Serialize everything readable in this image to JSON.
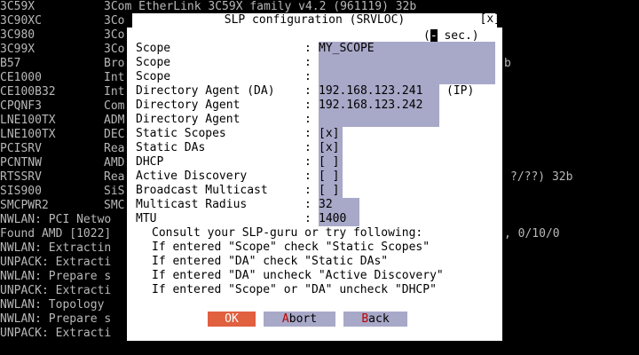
{
  "background_lines": [
    {
      "left": "3C59X",
      "right": "3Com EtherLink 3C59X family v4.2 (961119) 32b"
    },
    {
      "left": "3C90XC",
      "right": "3Co"
    },
    {
      "left": "3C980",
      "right": "3Co"
    },
    {
      "left": "3C99X",
      "right": "3Co"
    },
    {
      "left": "B57",
      "right": "Bro"
    },
    {
      "left": "CE1000",
      "right": "Int"
    },
    {
      "left": "CE100B32",
      "right": "Int"
    },
    {
      "left": "CPQNF3",
      "right": "Com"
    },
    {
      "left": "LNE100TX",
      "right": "ADM"
    },
    {
      "left": "LNE100TX",
      "right": "DEC"
    },
    {
      "left": "PCISRV",
      "right": "Rea"
    },
    {
      "left": "PCNTNW",
      "right": "AMD"
    },
    {
      "left": "RTSSRV",
      "right": "Rea"
    },
    {
      "left": "SIS900",
      "right": "SiS"
    },
    {
      "left": "SMCPWR2",
      "right": "SMC"
    },
    {
      "left": "NWLAN: PCI Netwo",
      "right": ""
    },
    {
      "left": "Found AMD [1022]",
      "right": ""
    },
    {
      "left": "NWLAN: Extractin",
      "right": ""
    },
    {
      "left": "UNPACK: Extracti",
      "right": ""
    },
    {
      "left": "NWLAN: Prepare s",
      "right": ""
    },
    {
      "left": "UNPACK: Extracti",
      "right": ""
    },
    {
      "left": "NWLAN: Topology",
      "right": ""
    },
    {
      "left": "NWLAN: Prepare s",
      "right": ""
    },
    {
      "left": "UNPACK: Extracti",
      "right": ""
    }
  ],
  "background_right_fragments": {
    "b57_tail": "b",
    "rtssrv_tail": "?/??) 32b",
    "found_tail": ", 0/10/0"
  },
  "dialog": {
    "title": "SLP configuration (SRVLOC)",
    "close": "[x]",
    "timer_cursor": "-",
    "timer_text": " sec.)",
    "timer_open": "(",
    "colon": ":"
  },
  "fields": [
    {
      "label": "Scope",
      "value": "MY_SCOPE"
    },
    {
      "label": "Scope",
      "value": ""
    },
    {
      "label": "Scope",
      "value": ""
    },
    {
      "label": "Directory Agent (DA)",
      "value": "192.168.123.241",
      "suffix": "(IP)"
    },
    {
      "label": "Directory Agent",
      "value": "192.168.123.242"
    },
    {
      "label": "Directory Agent",
      "value": ""
    },
    {
      "label": "Static Scopes",
      "value": "[x]"
    },
    {
      "label": "Static DAs",
      "value": "[x]"
    },
    {
      "label": "DHCP",
      "value": "[ ]"
    },
    {
      "label": "Active Discovery",
      "value": "[ ]"
    },
    {
      "label": "Broadcast Multicast",
      "value": "[ ]"
    },
    {
      "label": "Multicast Radius",
      "value": "32"
    },
    {
      "label": "MTU",
      "value": "1400"
    }
  ],
  "help": [
    "Consult your SLP-guru or try following:",
    "If entered \"Scope\" check \"Static Scopes\"",
    "If entered \"DA\" check \"Static DAs\"",
    "If entered \"DA\" uncheck \"Active Discovery\"",
    "If entered \"Scope\" or \"DA\" uncheck \"DHCP\""
  ],
  "buttons": {
    "ok": "OK",
    "abort_hot": "A",
    "abort_rest": "bort",
    "back_hot": "B",
    "back_rest": "ack"
  },
  "colors": {
    "dialog_bg": "#ffffff",
    "field_bg": "#a8a8c8",
    "ok_bg": "#e06040",
    "hotkey": "#c00000"
  }
}
